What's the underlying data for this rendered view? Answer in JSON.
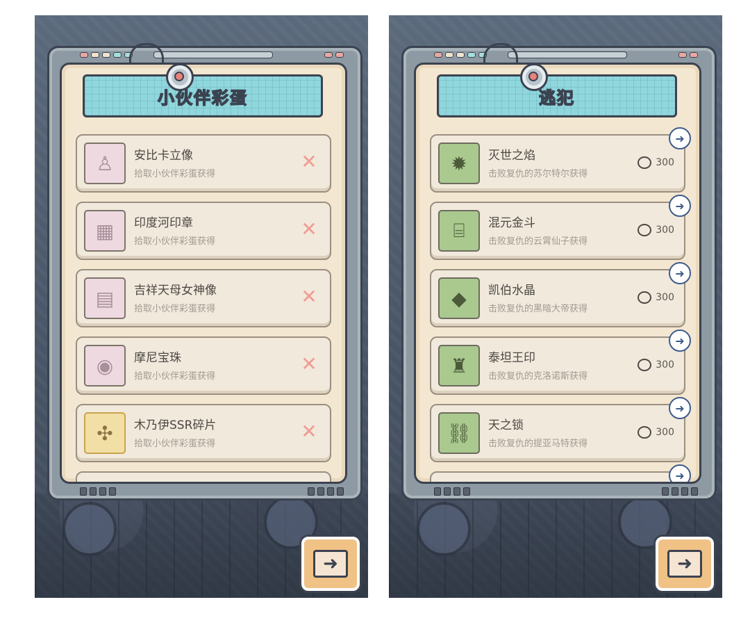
{
  "screens": [
    {
      "title": "小伙伴彩蛋",
      "items": [
        {
          "name": "安比卡立像",
          "source": "拾取小伙伴彩蛋获得",
          "icon": "statue-icon"
        },
        {
          "name": "印度河印章",
          "source": "拾取小伙伴彩蛋获得",
          "icon": "seal-icon"
        },
        {
          "name": "吉祥天母女神像",
          "source": "拾取小伙伴彩蛋获得",
          "icon": "scroll-icon"
        },
        {
          "name": "摩尼宝珠",
          "source": "拾取小伙伴彩蛋获得",
          "icon": "pearl-icon"
        },
        {
          "name": "木乃伊SSR碎片",
          "source": "拾取小伙伴彩蛋获得",
          "icon": "mummy-fragment-icon"
        }
      ]
    },
    {
      "title": "逃犯",
      "items": [
        {
          "name": "灭世之焰",
          "source": "击败复仇的苏尔特尔获得",
          "cost": "300",
          "icon": "flame-icon"
        },
        {
          "name": "混元金斗",
          "source": "击败复仇的云霄仙子获得",
          "cost": "300",
          "icon": "bronze-vessel-icon"
        },
        {
          "name": "凯伯水晶",
          "source": "击败复仇的黑暗大帝获得",
          "cost": "300",
          "icon": "crystal-icon"
        },
        {
          "name": "泰坦王印",
          "source": "击败复仇的克洛诺斯获得",
          "cost": "300",
          "icon": "eagle-seal-icon"
        },
        {
          "name": "天之锁",
          "source": "击败复仇的提亚马特获得",
          "cost": "300",
          "icon": "chain-icon"
        }
      ]
    }
  ],
  "colors": {
    "panel_bg": "#f4e7d1",
    "banner_bg": "#8fd6dd",
    "x_mark": "#ef9c93",
    "go_button": "#3e5c8a",
    "next_button": "#f0c285"
  }
}
